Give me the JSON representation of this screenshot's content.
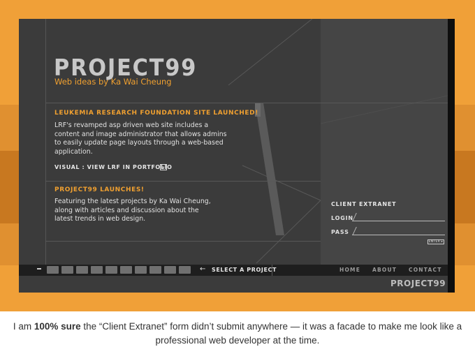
{
  "brand": {
    "title": "PROJECT99",
    "subtitle": "Web ideas by Ka Wai Cheung"
  },
  "news": [
    {
      "title": "LEUKEMIA RESEARCH FOUNDATION SITE LAUNCHED!",
      "lines": [
        "LRF's revamped asp driven web site includes a",
        "content and image administrator that allows admins",
        "to easily update page layouts through a web-based",
        "application."
      ],
      "link_label": "VISUAL :  VIEW LRF IN PORTFOLIO"
    },
    {
      "title": "PROJECT99 LAUNCHES!",
      "lines": [
        "Featuring the latest projects by Ka Wai Cheung,",
        "along with articles and discussion about the",
        "latest trends in web design."
      ]
    }
  ],
  "extranet": {
    "title": "CLIENT EXTRANET",
    "login_label": "LOGIN",
    "pass_label": "PASS",
    "login_value": "",
    "pass_value": "",
    "enter_label": "ENTER ▸"
  },
  "nav": {
    "select_label": "SELECT A PROJECT",
    "links": [
      "HOME",
      "ABOUT",
      "CONTACT"
    ],
    "footer_logo": "PROJECT99"
  },
  "caption": {
    "prefix": "I am ",
    "bold": "100% sure",
    "rest": " the “Client Extranet” form didn’t submit anywhere — it was a facade to make me look like a professional web developer at the time."
  },
  "colors": {
    "accent": "#f0a030",
    "panel": "#3b3b3b",
    "backdrop": "#f0a038"
  }
}
